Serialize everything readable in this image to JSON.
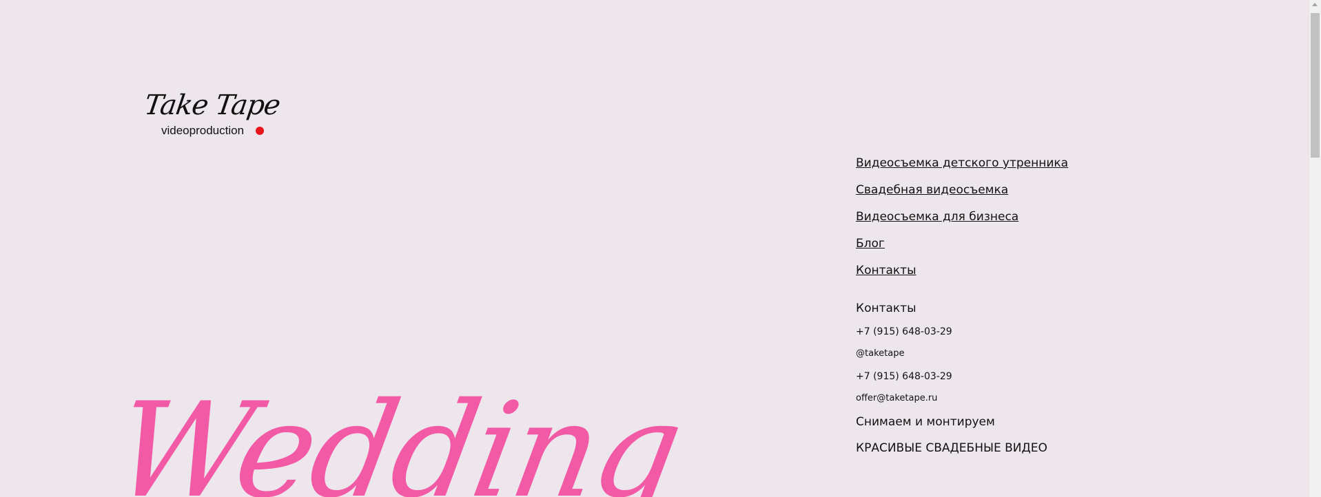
{
  "logo": {
    "script_text": "Take Tape",
    "subtitle": "videoproduction",
    "dot_color": "#e8141b"
  },
  "nav": {
    "items": [
      {
        "label": "Видеосъемка детского утренника"
      },
      {
        "label": "Свадебная видеосъемка"
      },
      {
        "label": "Видеосъемка для бизнеса"
      },
      {
        "label": "Блог"
      },
      {
        "label": "Контакты"
      }
    ]
  },
  "contacts": {
    "heading": "Контакты",
    "phone_1": "+7 (915) 648-03-29",
    "instagram": "@taketape",
    "phone_2": "+7 (915) 648-03-29",
    "email": "offer@taketape.ru",
    "tagline_1": "Снимаем и монтируем",
    "tagline_2": "КРАСИВЫЕ СВАДЕБНЫЕ ВИДЕО"
  },
  "hero": {
    "word": "Wedding",
    "color": "#f25aa6"
  },
  "colors": {
    "background": "#ede6ec",
    "text": "#111111"
  }
}
